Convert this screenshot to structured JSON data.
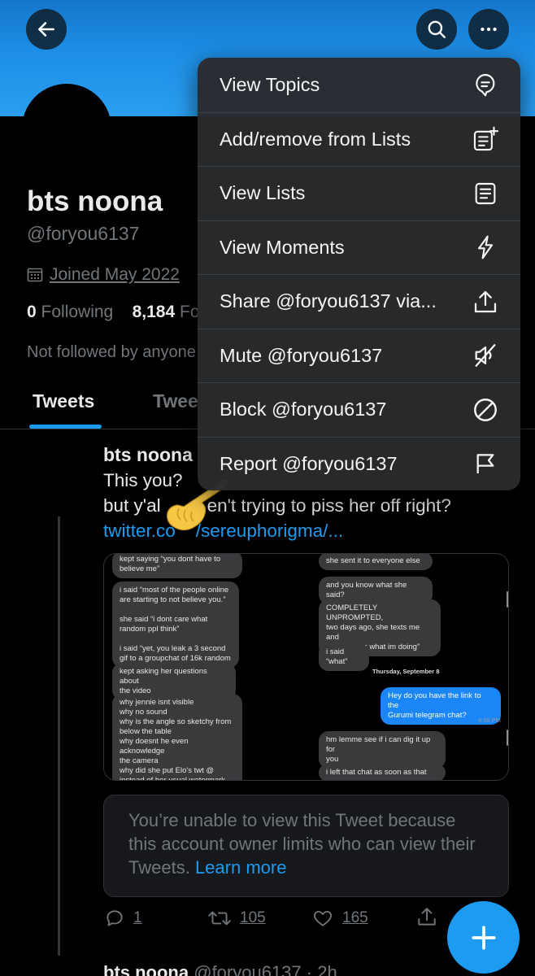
{
  "profile": {
    "name": "bts noona",
    "handle": "@foryou6137",
    "joined": "Joined May 2022",
    "following_count": "0",
    "following_label": "Following",
    "followers_count": "8,184",
    "followers_label": "Fol",
    "not_followed": "Not followed by anyone"
  },
  "tabs": {
    "tweets": "Tweets",
    "second": "Twee"
  },
  "menu": {
    "items": [
      {
        "label": "View Topics",
        "icon": "topics-icon"
      },
      {
        "label": "Add/remove from Lists",
        "icon": "list-add-icon"
      },
      {
        "label": "View Lists",
        "icon": "lists-icon"
      },
      {
        "label": "View Moments",
        "icon": "lightning-icon"
      },
      {
        "label": "Share @foryou6137 via...",
        "icon": "share-icon"
      },
      {
        "label": "Mute @foryou6137",
        "icon": "mute-icon"
      },
      {
        "label": "Block @foryou6137",
        "icon": "block-icon"
      },
      {
        "label": "Report @foryou6137",
        "icon": "flag-icon"
      }
    ]
  },
  "tweet": {
    "author": "bts noona",
    "line1": "This you?",
    "line2_a": "but y'al",
    "line2_b": "en't trying to piss her off right?",
    "link_a": "twitter.co",
    "link_b": "/sereuphorigma/...",
    "unavailable_text": "You’re unable to view this Tweet because this account owner limits who can view their Tweets.",
    "learn_more": "Learn more",
    "reply_count": "1",
    "retweet_count": "105",
    "like_count": "165"
  },
  "screenshot_chat": {
    "left": [
      "kept saying “you dont have to\nbelieve me”",
      "i said “most of the people online\nare starting to not believe you.”\n\nshe said “i dont care what\nrandom ppl think”\n\ni said “yet, you leak a 3 second\ngif to a groupchat of 16k random",
      "kept asking her questions about\nthe video",
      "why jennie isnt visible\nwhy no sound\nwhy is the angle so sketchy from\nbelow the table\nwhy doesnt he even acknowledge\nthe camera\nwhy did she put Elo's twt @\ninstead of her usual watermark"
    ],
    "right": [
      "she sent it to everyone else",
      "and you know what she said?",
      "COMPLETELY UNPROMPTED,\ntwo days ago, she texts me and\nsays “guess what im doing”",
      "i said “what”",
      "Hey do you have the link to the\nGurumi telegram chat?",
      "hm lemme see if i can dig it up for\nyou",
      "i left that chat as soon as that"
    ],
    "date": "Thursday, September 8",
    "time": "4:58 PM"
  },
  "next_tweet": {
    "author": "bts noona",
    "meta": "@foryou6137 · 2h"
  },
  "colors": {
    "accent": "#1d9bf0",
    "banner": "#1d8ee6",
    "background": "#000000",
    "menu": "#28292c"
  }
}
